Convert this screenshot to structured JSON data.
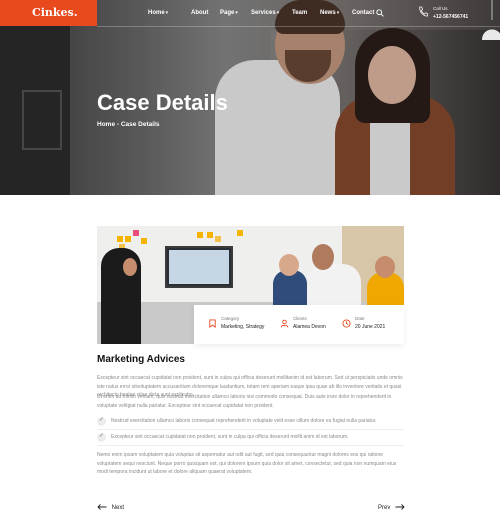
{
  "brand": {
    "logo": "Cinkes.",
    "accent": "#e8491d"
  },
  "nav": [
    {
      "label": "Home",
      "dropdown": true
    },
    {
      "label": "About",
      "dropdown": false
    },
    {
      "label": "Page",
      "dropdown": true
    },
    {
      "label": "Services",
      "dropdown": true
    },
    {
      "label": "Team",
      "dropdown": false
    },
    {
      "label": "News",
      "dropdown": true
    },
    {
      "label": "Contact",
      "dropdown": false
    }
  ],
  "call": {
    "label": "Call Us",
    "number": "+12-567456741"
  },
  "hero": {
    "title": "Case Details",
    "breadcrumb": "Home - Case Details"
  },
  "case_info": [
    {
      "icon": "bookmark-icon",
      "key": "Category",
      "value": "Marketing, Strategy"
    },
    {
      "icon": "user-icon",
      "key": "Clients",
      "value": "Alamea Devon"
    },
    {
      "icon": "clock-icon",
      "key": "Date",
      "value": "20 June 2021"
    }
  ],
  "content": {
    "title": "Marketing Advices",
    "paragraph1": "Excepteur sint occaecat cupidatat non proident, sunt in culpa qui officia deserunt mollitanim id est laborum. Sed ut perspiciatis unde omnis iste natus error sitvoluptatem accusantium doloremque laudantium, totam rem aperiam eaque ipsa quae ab illo inventore veritatis et quasi architecto beatae vitae dicta sunt explicabo.",
    "paragraph2": "Ut enim ad minim veniam, quis nostrud exercitation ullamco laboris nisi commodo consequat. Duis aute irure dolor in reprehenderit in voluptate velitgiat nulla pariatur. Excepteur sint occaecat cupidatat non proident.",
    "checklist": [
      "Nostrud exercitation ullamco laboris consequat reprehenderit in voluptate velit esse cillum dolore eu fugiat nulla pariatur.",
      "Excepteur sint occaecat cupidatat non proident, sunt in culpa qui officia deserunt mollit anim id est laborum."
    ],
    "paragraph3": "Nemo enim ipsam voluptatem quia voluptas sit aspernatur aut odit aut fugit, sed quia consequuntur magni dolores eos qui ratione voluptatem sequi nesciunt. Neque porro quisquam est, qui dolorem ipsum quia dolor sit amet, consectetur, sed quia non numquam eius modi tempora incidunt ut labore et dolore aliquam quaerat voluptatem."
  },
  "pager": {
    "prev": "Next",
    "next": "Prev"
  }
}
